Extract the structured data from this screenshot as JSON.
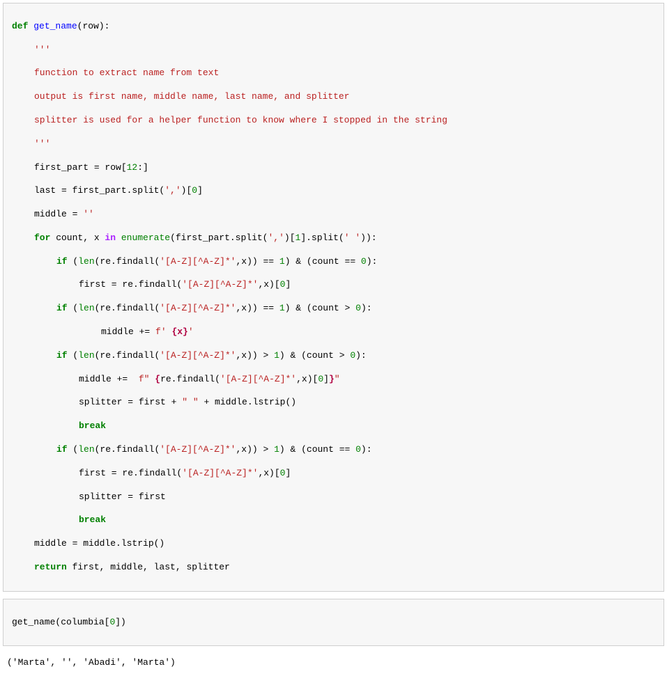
{
  "code_cell_1": {
    "l1_def": "def",
    "l1_fn": "get_name",
    "l1_rest": "(row):",
    "l2_str": "'''",
    "l3_str": "function to extract name from text",
    "l4_str": "output is first name, middle name, last name, and splitter",
    "l5_str": "splitter is used for a helper function to know where I stopped in the string",
    "l6_str": "'''",
    "l7_a": "first_part = row[",
    "l7_n": "12",
    "l7_b": ":]",
    "l8_a": "last = first_part.split(",
    "l8_s": "','",
    "l8_b": ")[",
    "l8_n": "0",
    "l8_c": "]",
    "l9_a": "middle = ",
    "l9_s": "''",
    "l10_for": "for",
    "l10_a": " count, x ",
    "l10_in": "in",
    "l10_b": " ",
    "l10_enum": "enumerate",
    "l10_c": "(first_part.split(",
    "l10_s1": "','",
    "l10_d": ")[",
    "l10_n1": "1",
    "l10_e": "].split(",
    "l10_s2": "' '",
    "l10_f": ")):",
    "l11_if": "if",
    "l11_a": " (",
    "l11_len": "len",
    "l11_b": "(re.findall(",
    "l11_s": "'[A-Z][^A-Z]*'",
    "l11_c": ",x)) == ",
    "l11_n1": "1",
    "l11_d": ") & (count == ",
    "l11_n2": "0",
    "l11_e": "):",
    "l12_a": "first = re.findall(",
    "l12_s": "'[A-Z][^A-Z]*'",
    "l12_b": ",x)[",
    "l12_n": "0",
    "l12_c": "]",
    "l13_if": "if",
    "l13_a": " (",
    "l13_len": "len",
    "l13_b": "(re.findall(",
    "l13_s": "'[A-Z][^A-Z]*'",
    "l13_c": ",x)) == ",
    "l13_n1": "1",
    "l13_d": ") & (count > ",
    "l13_n2": "0",
    "l13_e": "):",
    "l14_a": "middle += ",
    "l14_s1": "f'",
    "l14_s2": " ",
    "l14_i": "{x}",
    "l14_s3": "'",
    "l15_if": "if",
    "l15_a": " (",
    "l15_len": "len",
    "l15_b": "(re.findall(",
    "l15_s": "'[A-Z][^A-Z]*'",
    "l15_c": ",x)) > ",
    "l15_n1": "1",
    "l15_d": ") & (count > ",
    "l15_n2": "0",
    "l15_e": "):",
    "l16_a": "middle +=  ",
    "l16_s1": "f\"",
    "l16_s2": " ",
    "l16_i1": "{",
    "l16_b": "re.findall(",
    "l16_s3": "'[A-Z][^A-Z]*'",
    "l16_c": ",x)[",
    "l16_n": "0",
    "l16_d": "]",
    "l16_i2": "}",
    "l16_s4": "\"",
    "l17_a": "splitter = first + ",
    "l17_s": "\" \"",
    "l17_b": " + middle.lstrip()",
    "l18_break": "break",
    "l19_if": "if",
    "l19_a": " (",
    "l19_len": "len",
    "l19_b": "(re.findall(",
    "l19_s": "'[A-Z][^A-Z]*'",
    "l19_c": ",x)) > ",
    "l19_n1": "1",
    "l19_d": ") & (count == ",
    "l19_n2": "0",
    "l19_e": "):",
    "l20_a": "first = re.findall(",
    "l20_s": "'[A-Z][^A-Z]*'",
    "l20_b": ",x)[",
    "l20_n": "0",
    "l20_c": "]",
    "l21": "splitter = first",
    "l22_break": "break",
    "l23": "middle = middle.lstrip()",
    "l24_ret": "return",
    "l24_a": " first, middle, last, splitter"
  },
  "code_cell_2": {
    "l1_a": "get_name(columbia[",
    "l1_n": "0",
    "l1_b": "])"
  },
  "output_1": "('Marta', '', 'Abadi', 'Marta')"
}
